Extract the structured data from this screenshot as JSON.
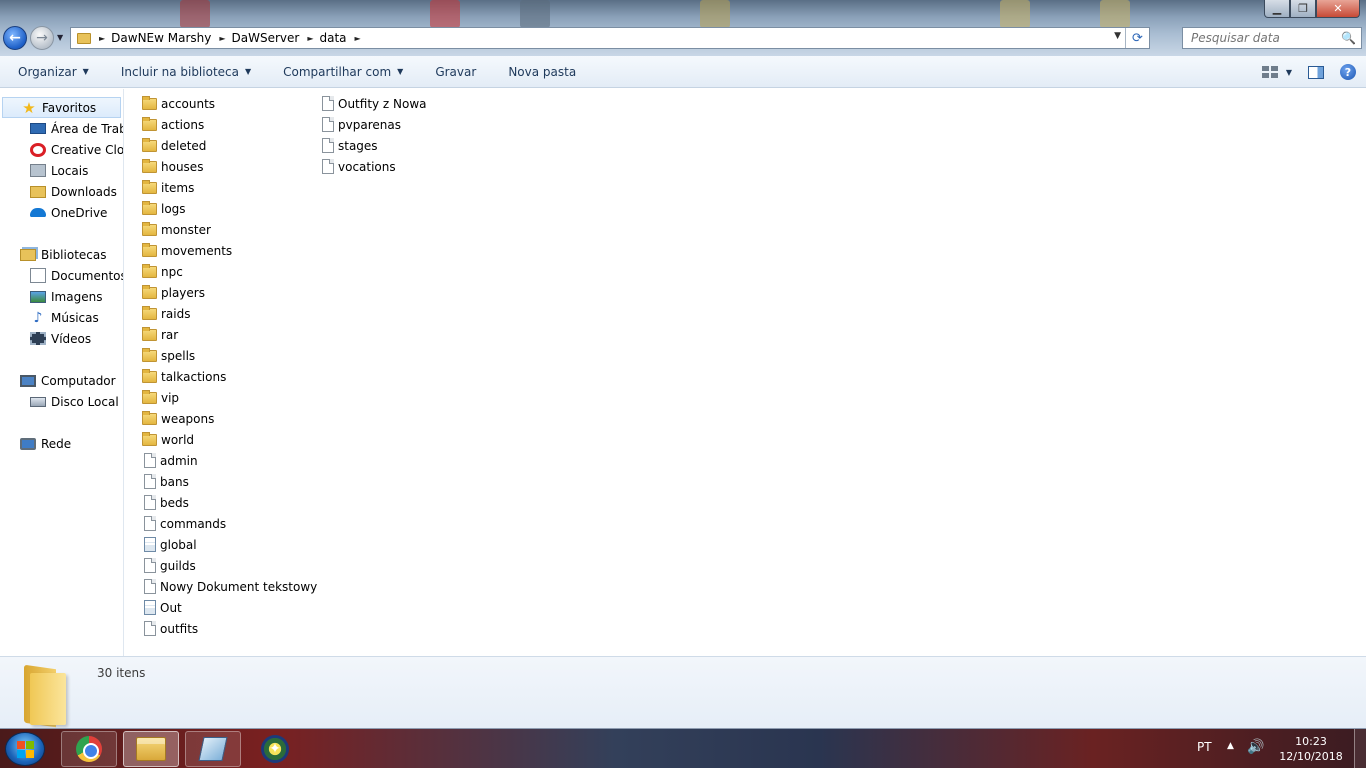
{
  "window": {
    "minimize_glyph": "▁",
    "maximize_glyph": "❐",
    "close_glyph": "✕"
  },
  "nav": {
    "back_glyph": "←",
    "forward_glyph": "→",
    "recent_glyph": "▼"
  },
  "address": {
    "breadcrumbs": [
      "DawNEw Marshy",
      "DaWServer",
      "data"
    ],
    "separator": "►",
    "dropdown_glyph": "▼",
    "refresh_glyph": "⟳"
  },
  "search": {
    "placeholder": "Pesquisar data",
    "icon_glyph": "🔍"
  },
  "toolbar": {
    "organize": "Organizar",
    "include_library": "Incluir na biblioteca",
    "share_with": "Compartilhar com",
    "burn": "Gravar",
    "new_folder": "Nova pasta",
    "caret": "▼",
    "help_glyph": "?"
  },
  "navpane": {
    "favorites": {
      "label": "Favoritos",
      "items": [
        "Área de Trabalho",
        "Creative Cloud Files",
        "Locais",
        "Downloads",
        "OneDrive"
      ]
    },
    "libraries": {
      "label": "Bibliotecas",
      "items": [
        "Documentos",
        "Imagens",
        "Músicas",
        "Vídeos"
      ]
    },
    "computer": {
      "label": "Computador",
      "items": [
        "Disco Local (C:)"
      ]
    },
    "network": {
      "label": "Rede"
    }
  },
  "files": {
    "column1": [
      {
        "name": "accounts",
        "type": "folder"
      },
      {
        "name": "actions",
        "type": "folder"
      },
      {
        "name": "deleted",
        "type": "folder"
      },
      {
        "name": "houses",
        "type": "folder"
      },
      {
        "name": "items",
        "type": "folder"
      },
      {
        "name": "logs",
        "type": "folder"
      },
      {
        "name": "monster",
        "type": "folder"
      },
      {
        "name": "movements",
        "type": "folder"
      },
      {
        "name": "npc",
        "type": "folder"
      },
      {
        "name": "players",
        "type": "folder"
      },
      {
        "name": "raids",
        "type": "folder"
      },
      {
        "name": "rar",
        "type": "folder"
      },
      {
        "name": "spells",
        "type": "folder"
      },
      {
        "name": "talkactions",
        "type": "folder"
      },
      {
        "name": "vip",
        "type": "folder"
      },
      {
        "name": "weapons",
        "type": "folder"
      },
      {
        "name": "world",
        "type": "folder"
      },
      {
        "name": "admin",
        "type": "file"
      },
      {
        "name": "bans",
        "type": "file"
      },
      {
        "name": "beds",
        "type": "file"
      },
      {
        "name": "commands",
        "type": "file"
      },
      {
        "name": "global",
        "type": "config"
      },
      {
        "name": "guilds",
        "type": "file"
      },
      {
        "name": "Nowy Dokument tekstowy",
        "type": "file"
      },
      {
        "name": "Out",
        "type": "config"
      },
      {
        "name": "outfits",
        "type": "file"
      }
    ],
    "column2": [
      {
        "name": "Outfity z Nowa",
        "type": "file"
      },
      {
        "name": "pvparenas",
        "type": "file"
      },
      {
        "name": "stages",
        "type": "file"
      },
      {
        "name": "vocations",
        "type": "file"
      }
    ]
  },
  "details": {
    "item_count": "30 itens"
  },
  "taskbar": {
    "language": "PT",
    "tray_up_glyph": "▲",
    "volume_glyph": "🔊",
    "time": "10:23",
    "date": "12/10/2018",
    "app4_glyph": "✦"
  },
  "colors": {
    "folder_yellow": "#e8c25a",
    "toolbar_text": "#1e395b",
    "selection_blue": "#dcebfc",
    "start_orb_blue": "#1b63b8"
  }
}
